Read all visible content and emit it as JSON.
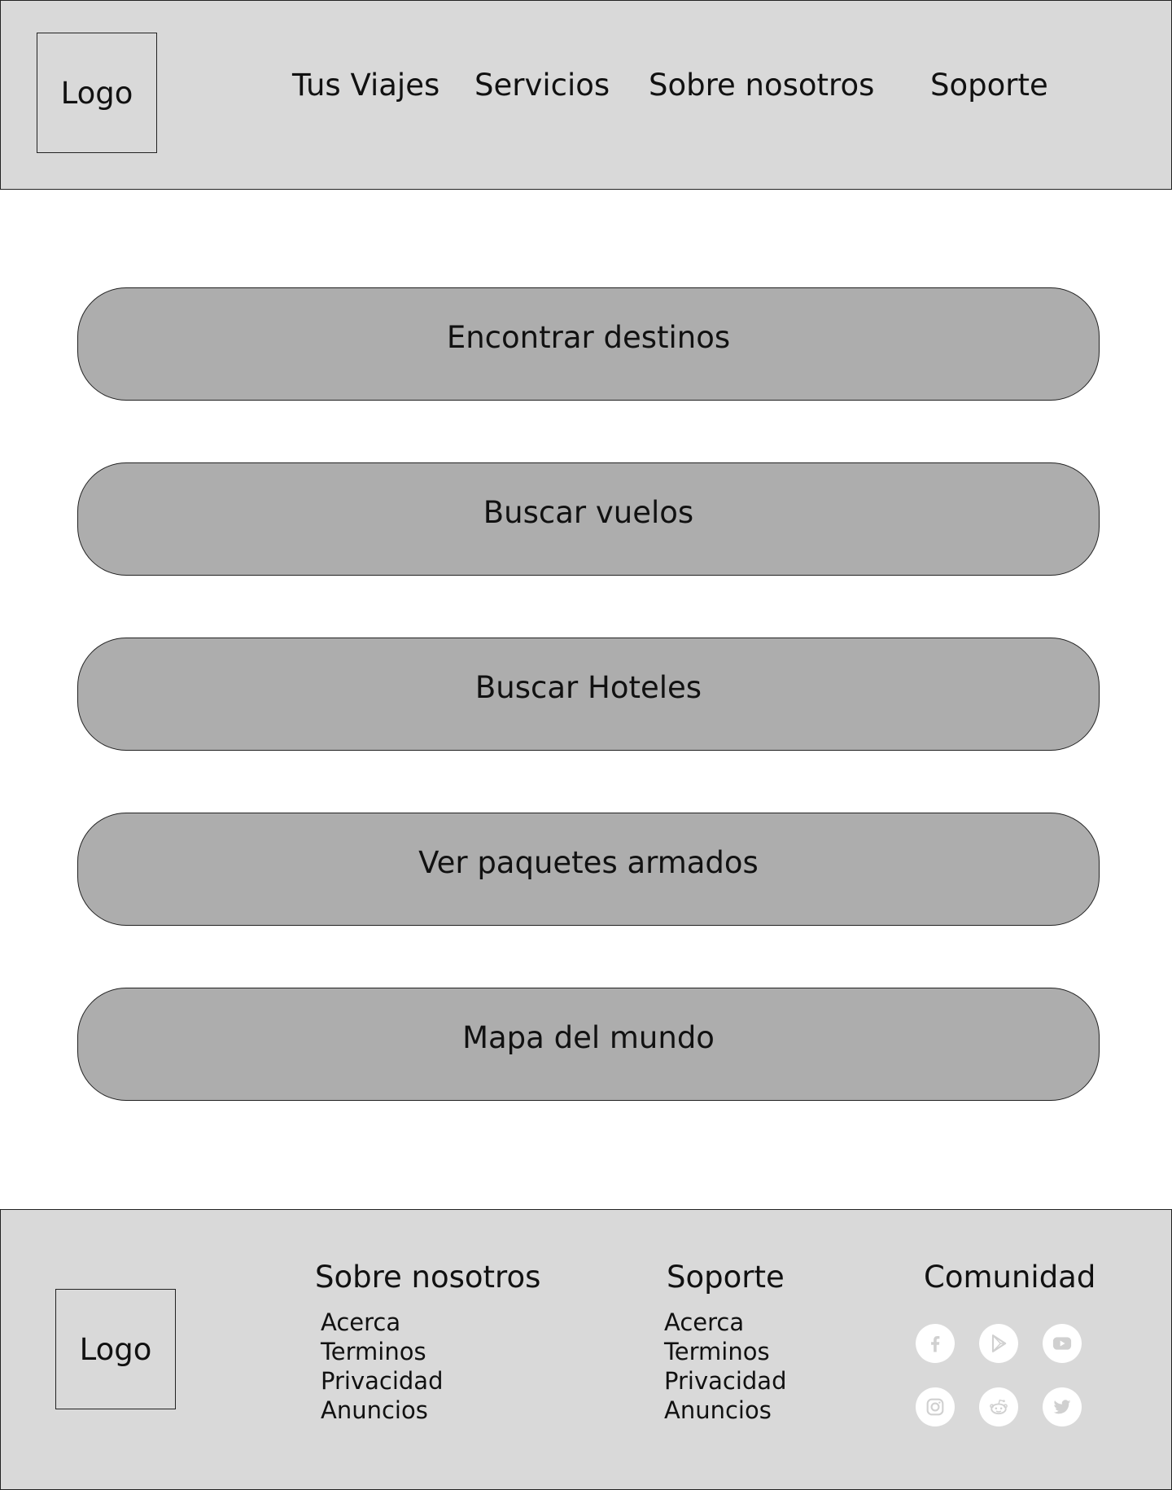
{
  "header": {
    "logo": "Logo",
    "nav": [
      "Tus Viajes",
      "Servicios",
      "Sobre nosotros",
      "Soporte"
    ]
  },
  "main": {
    "buttons": [
      "Encontrar destinos",
      "Buscar vuelos",
      "Buscar Hoteles",
      "Ver paquetes armados",
      "Mapa del mundo"
    ]
  },
  "footer": {
    "logo": "Logo",
    "about": {
      "heading": "Sobre nosotros",
      "links": [
        "Acerca",
        "Terminos",
        "Privacidad",
        "Anuncios"
      ]
    },
    "support": {
      "heading": "Soporte",
      "links": [
        "Acerca",
        "Terminos",
        "Privacidad",
        "Anuncios"
      ]
    },
    "community": {
      "heading": "Comunidad",
      "icons": [
        "facebook-icon",
        "play-store-icon",
        "youtube-icon",
        "instagram-icon",
        "reddit-icon",
        "twitter-icon"
      ]
    }
  },
  "colors": {
    "bar_background": "#d9d9d9",
    "button_background": "#adadad",
    "icon_background": "#ffffff",
    "icon_glyph": "#d0d0d0"
  }
}
